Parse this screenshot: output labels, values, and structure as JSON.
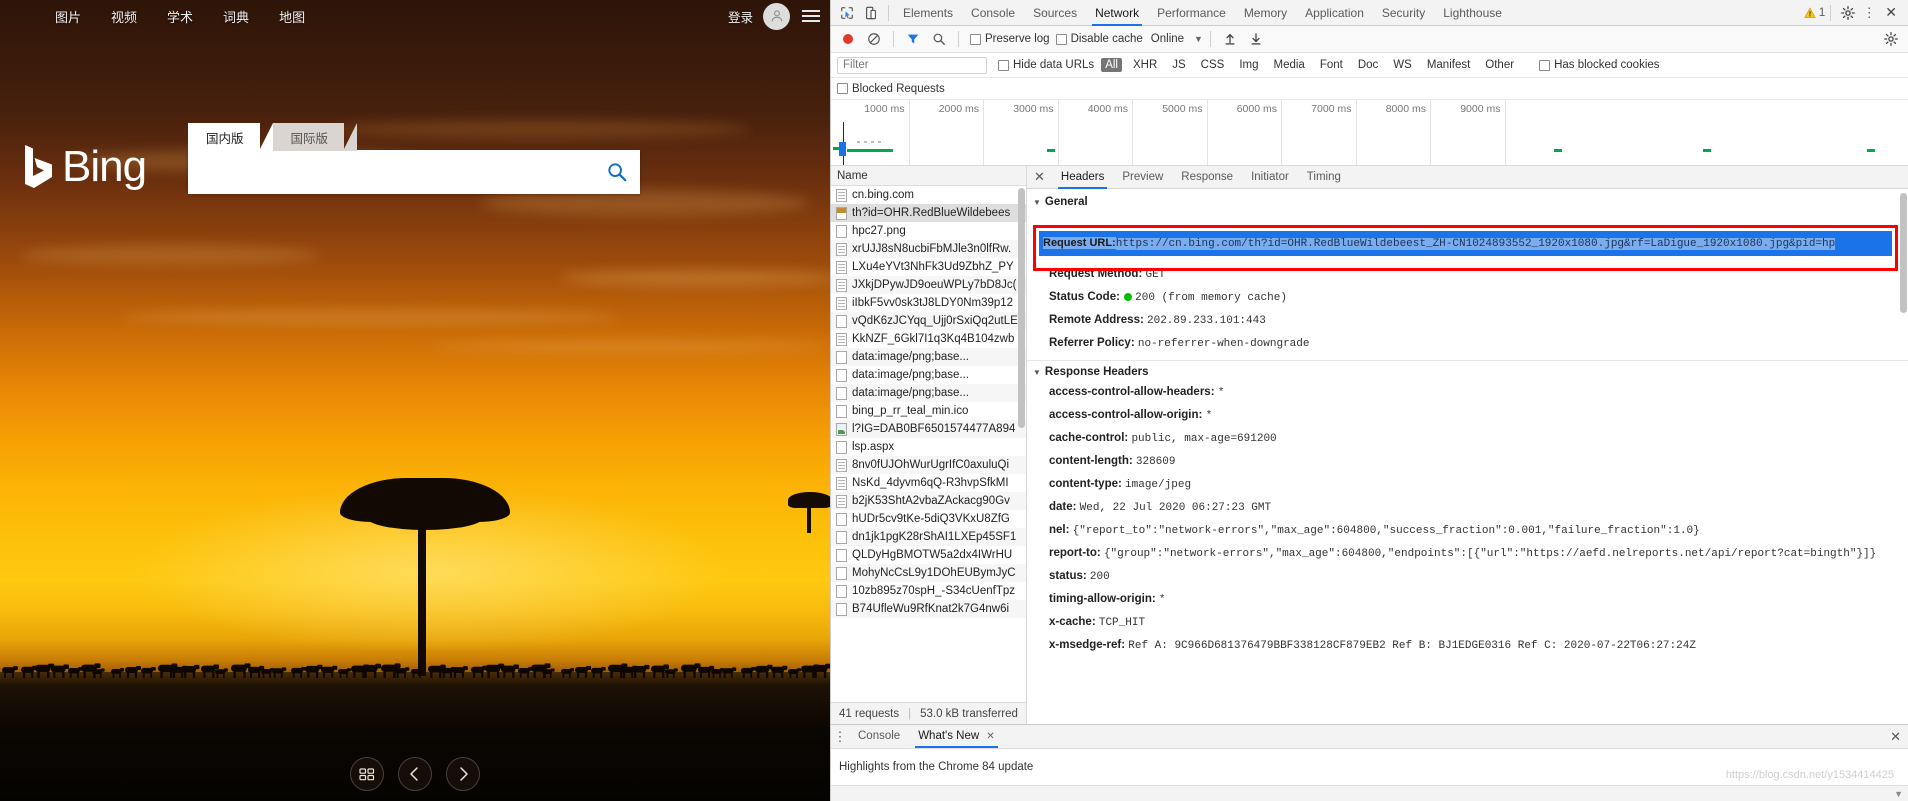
{
  "bing": {
    "nav_links": [
      "图片",
      "视频",
      "学术",
      "词典",
      "地图"
    ],
    "signin_label": "登录",
    "logo_text": "Bing",
    "tabs": [
      {
        "label": "国内版",
        "active": true
      },
      {
        "label": "国际版",
        "active": false
      }
    ],
    "search": {
      "value": "",
      "placeholder": ""
    },
    "bottom_buttons": [
      "grid-icon",
      "prev-arrow-icon",
      "next-arrow-icon"
    ]
  },
  "devtools": {
    "tabs": [
      "Elements",
      "Console",
      "Sources",
      "Network",
      "Performance",
      "Memory",
      "Application",
      "Security",
      "Lighthouse"
    ],
    "selected_tab": "Network",
    "warning_count": "1",
    "toolbar": {
      "preserve_log": "Preserve log",
      "disable_cache": "Disable cache",
      "throttle": "Online"
    },
    "filter": {
      "placeholder": "Filter",
      "value": "",
      "hide_data_urls": "Hide data URLs",
      "types": [
        "All",
        "XHR",
        "JS",
        "CSS",
        "Img",
        "Media",
        "Font",
        "Doc",
        "WS",
        "Manifest",
        "Other"
      ],
      "active_type": "All",
      "has_blocked_cookies": "Has blocked cookies",
      "blocked_requests": "Blocked Requests"
    },
    "timeline_ticks": [
      "1000 ms",
      "2000 ms",
      "3000 ms",
      "4000 ms",
      "5000 ms",
      "6000 ms",
      "7000 ms",
      "8000 ms",
      "9000 ms"
    ],
    "requests": {
      "column_header": "Name",
      "rows": [
        {
          "name": "cn.bing.com",
          "icon": "doc",
          "selected": false
        },
        {
          "name": "th?id=OHR.RedBlueWildebees",
          "icon": "img",
          "selected": true
        },
        {
          "name": "hpc27.png",
          "icon": "plain",
          "selected": false
        },
        {
          "name": "xrUJJ8sN8ucbiFbMJle3n0lfRw.",
          "icon": "doc",
          "selected": false
        },
        {
          "name": "LXu4eYVt3NhFk3Ud9ZbhZ_PY",
          "icon": "doc",
          "selected": false
        },
        {
          "name": "JXkjDPywJD9oeuWPLy7bD8Jc(",
          "icon": "doc",
          "selected": false
        },
        {
          "name": "iIbkF5vv0sk3tJ8LDY0Nm39p12",
          "icon": "doc",
          "selected": false
        },
        {
          "name": "vQdK6zJCYqq_Ujj0rSxiQq2utLE",
          "icon": "plain",
          "selected": false
        },
        {
          "name": "KkNZF_6Gkl7I1q3Kq4B104zwb",
          "icon": "doc",
          "selected": false
        },
        {
          "name": "data:image/png;base...",
          "icon": "plain",
          "selected": false
        },
        {
          "name": "data:image/png;base...",
          "icon": "plain",
          "selected": false
        },
        {
          "name": "data:image/png;base...",
          "icon": "plain",
          "selected": false
        },
        {
          "name": "bing_p_rr_teal_min.ico",
          "icon": "plain",
          "selected": false
        },
        {
          "name": "l?IG=DAB0BF6501574477A894",
          "icon": "pic",
          "selected": false
        },
        {
          "name": "lsp.aspx",
          "icon": "plain",
          "selected": false
        },
        {
          "name": "8nv0fUJOhWurUgrIfC0axuluQi",
          "icon": "doc",
          "selected": false
        },
        {
          "name": "NsKd_4dyvm6qQ-R3hvpSfkMI",
          "icon": "doc",
          "selected": false
        },
        {
          "name": "b2jK53ShtA2vbaZAckacg90Gv",
          "icon": "doc",
          "selected": false
        },
        {
          "name": "hUDr5cv9tKe-5diQ3VKxU8ZfG",
          "icon": "plain",
          "selected": false
        },
        {
          "name": "dn1jk1pgK28rShAI1LXEp45SF1",
          "icon": "plain",
          "selected": false
        },
        {
          "name": "QLDyHgBMOTW5a2dx4IWrHU",
          "icon": "plain",
          "selected": false
        },
        {
          "name": "MohyNcCsL9y1DOhEUBymJyC",
          "icon": "plain",
          "selected": false
        },
        {
          "name": "10zb895z70spH_-S34cUenfTpz",
          "icon": "plain",
          "selected": false
        },
        {
          "name": "B74UfleWu9RfKnat2k7G4nw6i",
          "icon": "plain",
          "selected": false
        }
      ],
      "footer_requests": "41 requests",
      "footer_transferred": "53.0 kB transferred"
    },
    "detail": {
      "tabs": [
        "Headers",
        "Preview",
        "Response",
        "Initiator",
        "Timing"
      ],
      "selected_tab": "Headers",
      "general_title": "General",
      "request_url_key": "Request URL:",
      "request_url_value": "https://cn.bing.com/th?id=OHR.RedBlueWildebeest_ZH-CN1024893552_1920x1080.jpg&rf=LaDigue_1920x1080.jpg&pid=hp",
      "general": [
        {
          "key": "Request Method:",
          "value": "GET"
        },
        {
          "key": "Status Code:",
          "value": "200",
          "extra": "(from memory cache)",
          "dot": "#00c000"
        },
        {
          "key": "Remote Address:",
          "value": "202.89.233.101:443"
        },
        {
          "key": "Referrer Policy:",
          "value": "no-referrer-when-downgrade"
        }
      ],
      "response_headers_title": "Response Headers",
      "response_headers": [
        {
          "key": "access-control-allow-headers:",
          "value": "*"
        },
        {
          "key": "access-control-allow-origin:",
          "value": "*"
        },
        {
          "key": "cache-control:",
          "value": "public, max-age=691200"
        },
        {
          "key": "content-length:",
          "value": "328609"
        },
        {
          "key": "content-type:",
          "value": "image/jpeg"
        },
        {
          "key": "date:",
          "value": "Wed, 22 Jul 2020 06:27:23 GMT"
        },
        {
          "key": "nel:",
          "value": "{\"report_to\":\"network-errors\",\"max_age\":604800,\"success_fraction\":0.001,\"failure_fraction\":1.0}"
        },
        {
          "key": "report-to:",
          "value": "{\"group\":\"network-errors\",\"max_age\":604800,\"endpoints\":[{\"url\":\"https://aefd.nelreports.net/api/report?cat=bingth\"}]}"
        },
        {
          "key": "status:",
          "value": "200"
        },
        {
          "key": "timing-allow-origin:",
          "value": "*"
        },
        {
          "key": "x-cache:",
          "value": "TCP_HIT"
        },
        {
          "key": "x-msedge-ref:",
          "value": "Ref A: 9C966D681376479BBF338128CF879EB2 Ref B: BJ1EDGE0316 Ref C: 2020-07-22T06:27:24Z"
        }
      ]
    },
    "drawer": {
      "tabs": [
        {
          "label": "Console",
          "active": false,
          "closable": false
        },
        {
          "label": "What's New",
          "active": true,
          "closable": true
        }
      ],
      "content_text": "Highlights from the Chrome 84 update",
      "watermark": "https://blog.csdn.net/y1534414425"
    }
  }
}
